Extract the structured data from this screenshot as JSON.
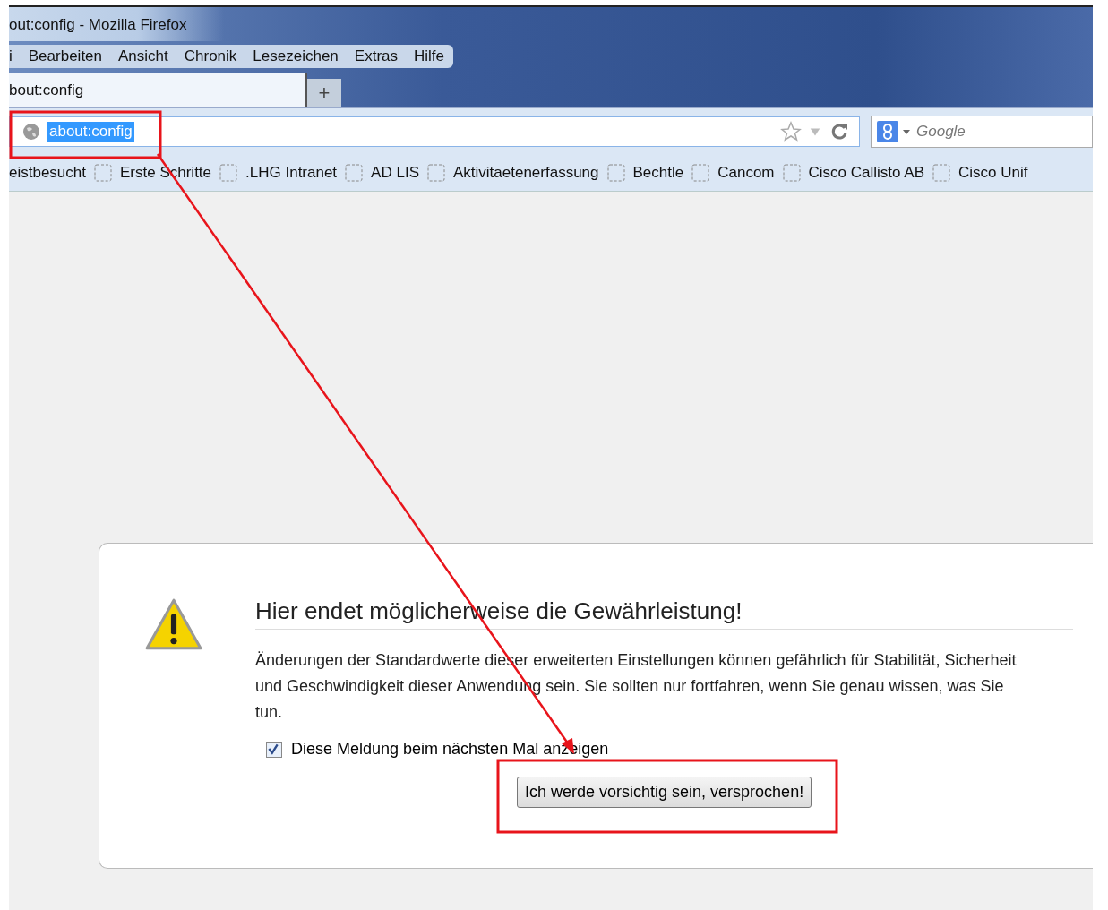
{
  "window": {
    "title": "out:config - Mozilla Firefox"
  },
  "menu": [
    "i",
    "Bearbeiten",
    "Ansicht",
    "Chronik",
    "Lesezeichen",
    "Extras",
    "Hilfe"
  ],
  "tabs": [
    {
      "label": "bout:config",
      "selected": true
    }
  ],
  "new_tab": "+",
  "address_bar": {
    "value": "about:config"
  },
  "search": {
    "placeholder": "Google"
  },
  "bookmarks": [
    "eistbesucht",
    "Erste Schritte",
    ".LHG Intranet",
    "AD LIS",
    "Aktivitaetenerfassung",
    "Bechtle",
    "Cancom",
    "Cisco Callisto AB",
    "Cisco Unif"
  ],
  "warning": {
    "title": "Hier endet möglicherweise die Gewährleistung!",
    "text": "Änderungen der Standardwerte dieser erweiterten Einstellungen können gefährlich für Stabilität, Sicherheit und Geschwindigkeit dieser Anwendung sein. Sie sollten nur fortfahren, wenn Sie genau wissen, was Sie tun.",
    "checkbox": {
      "label": "Diese Meldung beim nächsten Mal anzeigen",
      "checked": true
    },
    "button": "Ich werde vorsichtig sein, versprochen!"
  }
}
